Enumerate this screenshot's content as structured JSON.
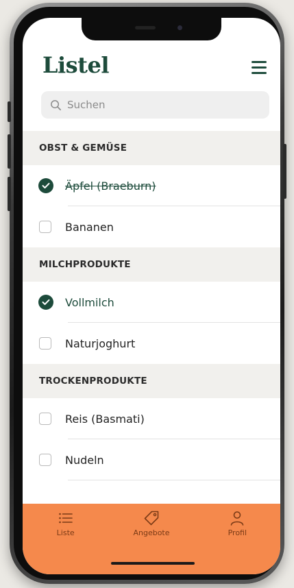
{
  "app": {
    "title": "Listel"
  },
  "search": {
    "placeholder": "Suchen"
  },
  "sections": [
    {
      "title": "OBST & GEMÜSE",
      "items": [
        {
          "label": "Äpfel (Braeburn)",
          "checked": true
        },
        {
          "label": "Bananen",
          "checked": false
        }
      ]
    },
    {
      "title": "MILCHPRODUKTE",
      "items": [
        {
          "label": "Vollmilch",
          "checked": true
        },
        {
          "label": "Naturjoghurt",
          "checked": false
        }
      ]
    },
    {
      "title": "TROCKENPRODUKTE",
      "items": [
        {
          "label": "Reis (Basmati)",
          "checked": false
        },
        {
          "label": "Nudeln",
          "checked": false
        }
      ]
    }
  ],
  "nav": {
    "tabs": [
      {
        "label": "Liste",
        "icon": "list-icon"
      },
      {
        "label": "Angebote",
        "icon": "tag-icon"
      },
      {
        "label": "Profil",
        "icon": "person-icon"
      }
    ]
  },
  "colors": {
    "accent": "#1d4b3b",
    "nav_background": "#f5894c"
  }
}
